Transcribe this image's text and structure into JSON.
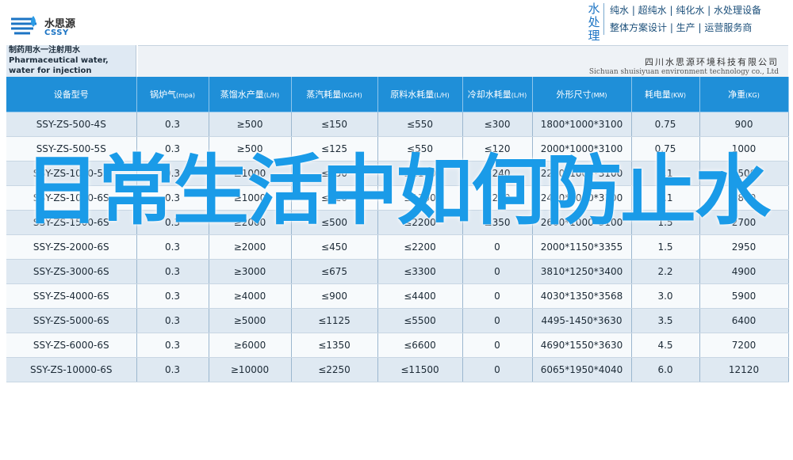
{
  "header": {
    "logo_cn": "水思源",
    "logo_en": "CSSY",
    "vertical_title": "水处理",
    "service_line1": "纯水 | 超纯水 | 纯化水 | 水处理设备",
    "service_line2": "整体方案设计 | 生产 | 运营服务商"
  },
  "product": {
    "name": "制药用水一注射用水 Pharmaceutical water, water for injection"
  },
  "company": {
    "name_cn": "四川水思源环境科技有限公司",
    "name_en": "Sichuan shuisiyuan environment technology co., Ltd"
  },
  "table": {
    "columns": [
      {
        "label": "设备型号",
        "unit": ""
      },
      {
        "label": "锅炉气",
        "unit": "(mpa)"
      },
      {
        "label": "蒸馏水产量",
        "unit": "(L/H)"
      },
      {
        "label": "蒸汽耗量",
        "unit": "(KG/H)"
      },
      {
        "label": "原料水耗量",
        "unit": "(L/H)"
      },
      {
        "label": "冷却水耗量",
        "unit": "(L/H)"
      },
      {
        "label": "外形尺寸",
        "unit": "(MM)"
      },
      {
        "label": "耗电量",
        "unit": "(KW)"
      },
      {
        "label": "净重",
        "unit": "(KG)"
      }
    ],
    "rows": [
      [
        "SSY-ZS-500-4S",
        "0.3",
        "≥500",
        "≤150",
        "≤550",
        "≤300",
        "1800*1000*3100",
        "0.75",
        "900"
      ],
      [
        "SSY-ZS-500-5S",
        "0.3",
        "≥500",
        "≤125",
        "≤550",
        "≤120",
        "2000*1000*3100",
        "0.75",
        "1000"
      ],
      [
        "SSY-ZS-1000-5S",
        "0.3",
        "≥1000",
        "≤250",
        "≤1100",
        "≤240",
        "2200*1000*3100",
        "1.1",
        "1500"
      ],
      [
        "SSY-ZS-1000-6S",
        "0.3",
        "≥1000",
        "≤220",
        "≤1100",
        "≤200",
        "2400*1000*3100",
        "1.1",
        "1800"
      ],
      [
        "SSY-ZS-1500-6S",
        "0.3",
        "≥2000",
        "≤500",
        "≤2200",
        "≤350",
        "2600*1000*3100",
        "1.5",
        "2700"
      ],
      [
        "SSY-ZS-2000-6S",
        "0.3",
        "≥2000",
        "≤450",
        "≤2200",
        "0",
        "2000*1150*3355",
        "1.5",
        "2950"
      ],
      [
        "SSY-ZS-3000-6S",
        "0.3",
        "≥3000",
        "≤675",
        "≤3300",
        "0",
        "3810*1250*3400",
        "2.2",
        "4900"
      ],
      [
        "SSY-ZS-4000-6S",
        "0.3",
        "≥4000",
        "≤900",
        "≤4400",
        "0",
        "4030*1350*3568",
        "3.0",
        "5900"
      ],
      [
        "SSY-ZS-5000-6S",
        "0.3",
        "≥5000",
        "≤1125",
        "≤5500",
        "0",
        "4495-1450*3630",
        "3.5",
        "6400"
      ],
      [
        "SSY-ZS-6000-6S",
        "0.3",
        "≥6000",
        "≤1350",
        "≤6600",
        "0",
        "4690*1550*3630",
        "4.5",
        "7200"
      ],
      [
        "SSY-ZS-10000-6S",
        "0.3",
        "≥10000",
        "≤2250",
        "≤11500",
        "0",
        "6065*1950*4040",
        "6.0",
        "12120"
      ]
    ]
  },
  "overlay": {
    "headline": "日常生活中如何防止水"
  },
  "colors": {
    "header_blue": "#1f8fd8",
    "headline_blue": "#1a9be8",
    "row_odd": "#dfe9f2",
    "row_even": "#f7fafc"
  }
}
